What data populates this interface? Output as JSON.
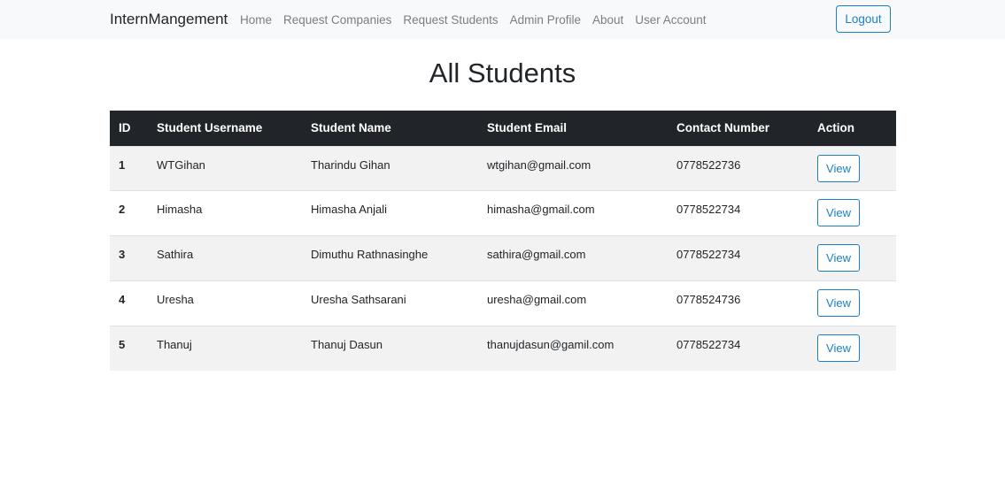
{
  "navbar": {
    "brand": "InternMangement",
    "links": [
      "Home",
      "Request Companies",
      "Request Students",
      "Admin Profile",
      "About",
      "User Account"
    ],
    "logout_label": "Logout"
  },
  "page": {
    "title": "All Students"
  },
  "table": {
    "headers": [
      "ID",
      "Student Username",
      "Student Name",
      "Student Email",
      "Contact Number",
      "Action"
    ],
    "view_label": "View",
    "rows": [
      {
        "id": "1",
        "username": "WTGihan",
        "name": "Tharindu Gihan",
        "email": "wtgihan@gmail.com",
        "contact": "0778522736"
      },
      {
        "id": "2",
        "username": "Himasha",
        "name": "Himasha Anjali",
        "email": "himasha@gmail.com",
        "contact": "0778522734"
      },
      {
        "id": "3",
        "username": "Sathira",
        "name": "Dimuthu Rathnasinghe",
        "email": "sathira@gmail.com",
        "contact": "0778522734"
      },
      {
        "id": "4",
        "username": "Uresha",
        "name": "Uresha Sathsarani",
        "email": "uresha@gmail.com",
        "contact": "0778524736"
      },
      {
        "id": "5",
        "username": "Thanuj",
        "name": "Thanuj Dasun",
        "email": "thanujdasun@gamil.com",
        "contact": "0778522734"
      }
    ]
  },
  "colors": {
    "navbar_bg": "#f8f9fa",
    "header_bg": "#212529",
    "accent": "#1a7fc9",
    "striped_row": "#f2f2f2"
  }
}
